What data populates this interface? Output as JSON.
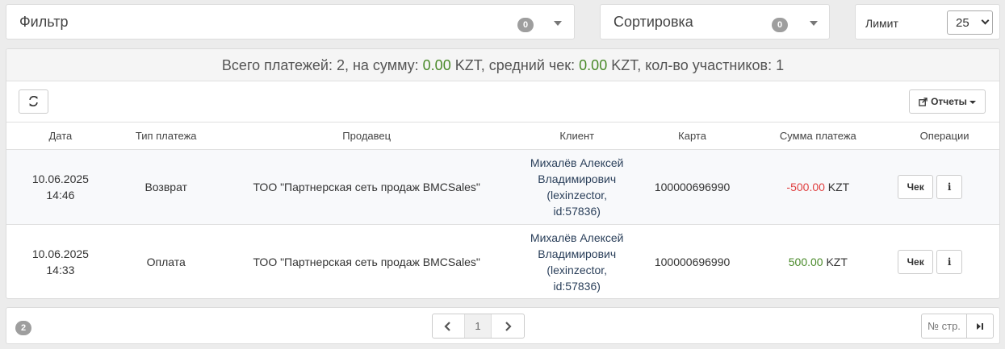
{
  "filter": {
    "label": "Фильтр",
    "count": "0"
  },
  "sort": {
    "label": "Сортировка",
    "count": "0"
  },
  "limit": {
    "label": "Лимит",
    "value": "25"
  },
  "summary": {
    "prefix": "Всего платежей: 2, на сумму: ",
    "sum": "0.00",
    "mid1": " KZT, средний чек: ",
    "avg": "0.00",
    "mid2": " KZT, кол-во участников: 1"
  },
  "toolbar": {
    "reports_label": "Отчеты"
  },
  "table": {
    "headers": [
      "Дата",
      "Тип платежа",
      "Продавец",
      "Клиент",
      "Карта",
      "Сумма платежа",
      "Операции"
    ],
    "rows": [
      {
        "date": "10.06.2025",
        "time": "14:46",
        "type": "Возврат",
        "seller": "ТОО \"Партнерская сеть продаж BMCSales\"",
        "client_l1": "Михалёв Алексей",
        "client_l2": "Владимирович",
        "client_l3": "(lexinzector,",
        "client_l4": "id:57836)",
        "card": "100000696990",
        "amount": "-500.00",
        "currency": "KZT",
        "check_label": "Чек",
        "info_label": "i"
      },
      {
        "date": "10.06.2025",
        "time": "14:33",
        "type": "Оплата",
        "seller": "ТОО \"Партнерская сеть продаж BMCSales\"",
        "client_l1": "Михалёв Алексей",
        "client_l2": "Владимирович",
        "client_l3": "(lexinzector,",
        "client_l4": "id:57836)",
        "card": "100000696990",
        "amount": "500.00",
        "currency": "KZT",
        "check_label": "Чек",
        "info_label": "i"
      }
    ]
  },
  "footer": {
    "total": "2",
    "current_page": "1",
    "page_input_placeholder": "№ стр."
  },
  "colors": {
    "positive": "#4a8a2a",
    "negative": "#e04040",
    "badge": "#9e9e9e"
  },
  "icons": [
    "refresh-icon",
    "export-icon",
    "chevron-left-icon",
    "chevron-right-icon",
    "last-page-icon",
    "info-icon"
  ]
}
